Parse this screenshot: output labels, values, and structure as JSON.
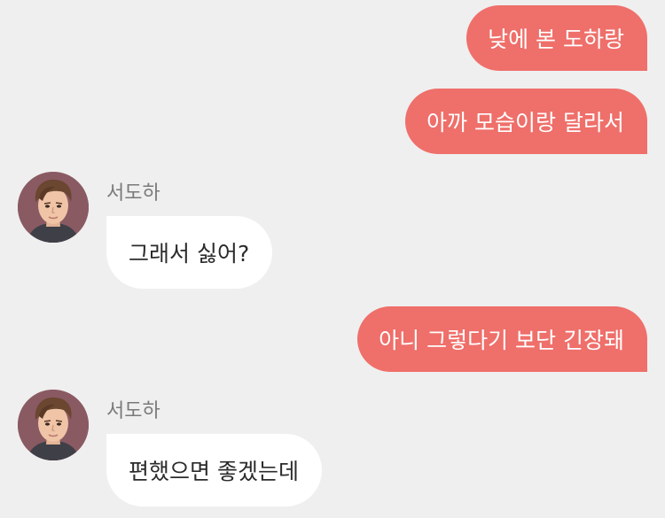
{
  "theme": {
    "background": "#efefef",
    "outgoing_bubble": "#ef6f6a",
    "incoming_bubble": "#ffffff"
  },
  "messages": [
    {
      "direction": "outgoing",
      "text": "낮에 본 도하랑"
    },
    {
      "direction": "outgoing",
      "text": "아까 모습이랑 달라서"
    },
    {
      "direction": "incoming",
      "sender": "서도하",
      "avatar_icon": "user-avatar-icon",
      "text": "그래서 싫어?"
    },
    {
      "direction": "outgoing",
      "text": "아니 그렇다기 보단 긴장돼"
    },
    {
      "direction": "incoming",
      "sender": "서도하",
      "avatar_icon": "user-avatar-icon",
      "text": "편했으면 좋겠는데"
    }
  ]
}
